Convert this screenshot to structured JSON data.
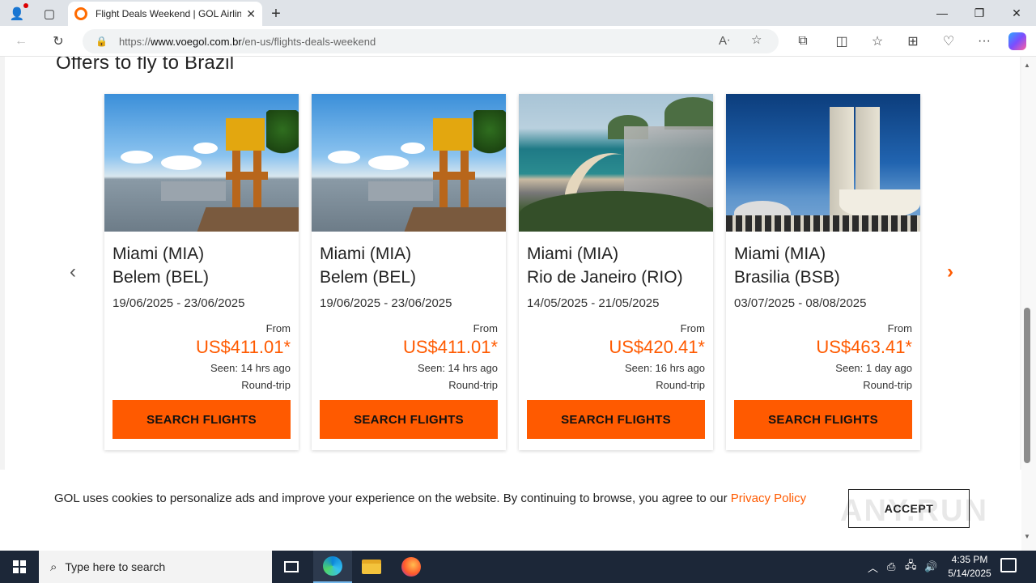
{
  "browser": {
    "tab_title": "Flight Deals Weekend | GOL Airlines",
    "url_prefix": "https://",
    "url_host": "www.voegol.com.br",
    "url_path": "/en-us/flights-deals-weekend"
  },
  "page": {
    "section_title": "Offers to fly to Brazil",
    "cards": [
      {
        "origin": "Miami (MIA)",
        "destination": "Belem (BEL)",
        "dates": "19/06/2025 - 23/06/2025",
        "from_label": "From",
        "price": "US$411.01*",
        "seen": "Seen: 14 hrs ago",
        "trip": "Round-trip",
        "button": "SEARCH FLIGHTS"
      },
      {
        "origin": "Miami (MIA)",
        "destination": "Belem (BEL)",
        "dates": "19/06/2025 - 23/06/2025",
        "from_label": "From",
        "price": "US$411.01*",
        "seen": "Seen: 14 hrs ago",
        "trip": "Round-trip",
        "button": "SEARCH FLIGHTS"
      },
      {
        "origin": "Miami (MIA)",
        "destination": "Rio de Janeiro (RIO)",
        "dates": "14/05/2025 - 21/05/2025",
        "from_label": "From",
        "price": "US$420.41*",
        "seen": "Seen: 16 hrs ago",
        "trip": "Round-trip",
        "button": "SEARCH FLIGHTS"
      },
      {
        "origin": "Miami (MIA)",
        "destination": "Brasilia (BSB)",
        "dates": "03/07/2025 - 08/08/2025",
        "from_label": "From",
        "price": "US$463.41*",
        "seen": "Seen: 1 day ago",
        "trip": "Round-trip",
        "button": "SEARCH FLIGHTS"
      }
    ]
  },
  "cookie_banner": {
    "text": "GOL uses cookies to personalize ads and improve your experience on the website. By continuing to browse, you agree to our ",
    "link": "Privacy Policy",
    "accept": "ACCEPT"
  },
  "watermark": "ANY.RUN",
  "taskbar": {
    "search_placeholder": "Type here to search",
    "time": "4:35 PM",
    "date": "5/14/2025"
  },
  "colors": {
    "brand_orange": "#ff5a00",
    "taskbar": "#1c2738"
  }
}
